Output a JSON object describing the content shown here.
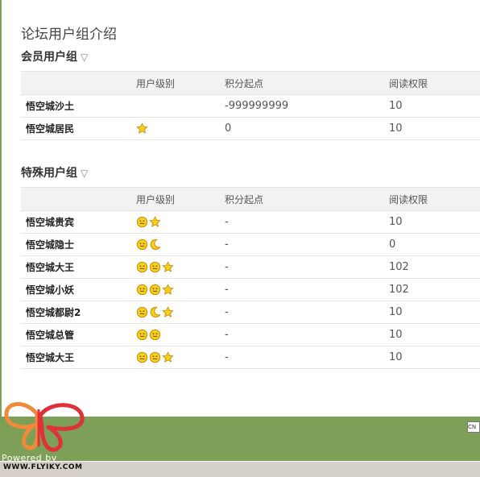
{
  "page": {
    "title": "论坛用户组介绍"
  },
  "columns": {
    "name": "",
    "level": "用户级别",
    "points": "积分起点",
    "read": "阅读权限"
  },
  "member_section": {
    "title": "会员用户组",
    "toggle": "▽",
    "rows": [
      {
        "name": "悟空城沙土",
        "icons": [],
        "points": "-999999999",
        "read": "10"
      },
      {
        "name": "悟空城居民",
        "icons": [
          "star-icon"
        ],
        "points": "0",
        "read": "10"
      }
    ]
  },
  "special_section": {
    "title": "特殊用户组",
    "toggle": "▽",
    "rows": [
      {
        "name": "悟空城贵宾",
        "icons": [
          "sun-icon",
          "star-icon"
        ],
        "points": "-",
        "read": "10"
      },
      {
        "name": "悟空城隐士",
        "icons": [
          "sun-icon",
          "moon-icon"
        ],
        "points": "-",
        "read": "0"
      },
      {
        "name": "悟空城大王",
        "icons": [
          "sun-icon",
          "sun-icon",
          "star-icon"
        ],
        "points": "-",
        "read": "102"
      },
      {
        "name": "悟空城小妖",
        "icons": [
          "sun-icon",
          "sun-icon",
          "star-icon"
        ],
        "points": "-",
        "read": "102"
      },
      {
        "name": "悟空城都尉2",
        "icons": [
          "sun-icon",
          "moon-icon",
          "star-icon"
        ],
        "points": "-",
        "read": "10"
      },
      {
        "name": "悟空城总管",
        "icons": [
          "sun-icon",
          "sun-icon"
        ],
        "points": "-",
        "read": "10"
      },
      {
        "name": "悟空城大王",
        "icons": [
          "sun-icon",
          "sun-icon",
          "star-icon"
        ],
        "points": "-",
        "read": "10"
      }
    ]
  },
  "footer": {
    "powered": "Powered by",
    "site": "WWW.FLYIKY.COM",
    "lang_button": "CN"
  },
  "colors": {
    "footer_green": "#7e9f57",
    "header_gray": "#f2f2f2",
    "icon_gold": "#f2c200"
  }
}
